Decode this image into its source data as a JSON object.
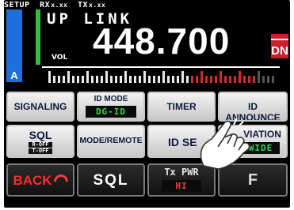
{
  "status_bar": {
    "left": "SETUP",
    "rx_prefix": "RX",
    "rx_value": "x.xx",
    "tx_prefix": "TX",
    "tx_value": "x.xx"
  },
  "band_letter": "A",
  "link_mode": "UP LINK",
  "frequency": "448.700",
  "volume_label": "VOL",
  "mode_badge": "DN",
  "meter": {
    "level_fraction": 0.62
  },
  "buttons": {
    "signaling": {
      "label": "SIGNALING"
    },
    "id_mode": {
      "label": "ID MODE",
      "value": "DG-ID"
    },
    "timer": {
      "label": "TIMER"
    },
    "id_announce": {
      "label": "ID ANNOUNCE"
    },
    "sql": {
      "label": "SQL",
      "line1": "R-OFF",
      "line2": "T-OFF"
    },
    "mode_remote": {
      "label": "MODE/REMOTE"
    },
    "id_set": {
      "label": "ID SE"
    },
    "deviation": {
      "label": "VIATION",
      "value": "WIDE"
    },
    "back": {
      "label": "BACK"
    },
    "sql_bottom": {
      "label": "SQL"
    },
    "tx_pwr": {
      "label": "Tx PWR",
      "value": "HI"
    },
    "f": {
      "label": "F"
    }
  },
  "colors": {
    "accent_blue": "#1e6fd9",
    "accent_green": "#2fbf3c",
    "badge_red": "#c8202e",
    "lcd_green": "#39d353"
  },
  "icons": {
    "pointer": "hand-pointer-icon",
    "back_arrow": "back-arrow-icon"
  }
}
